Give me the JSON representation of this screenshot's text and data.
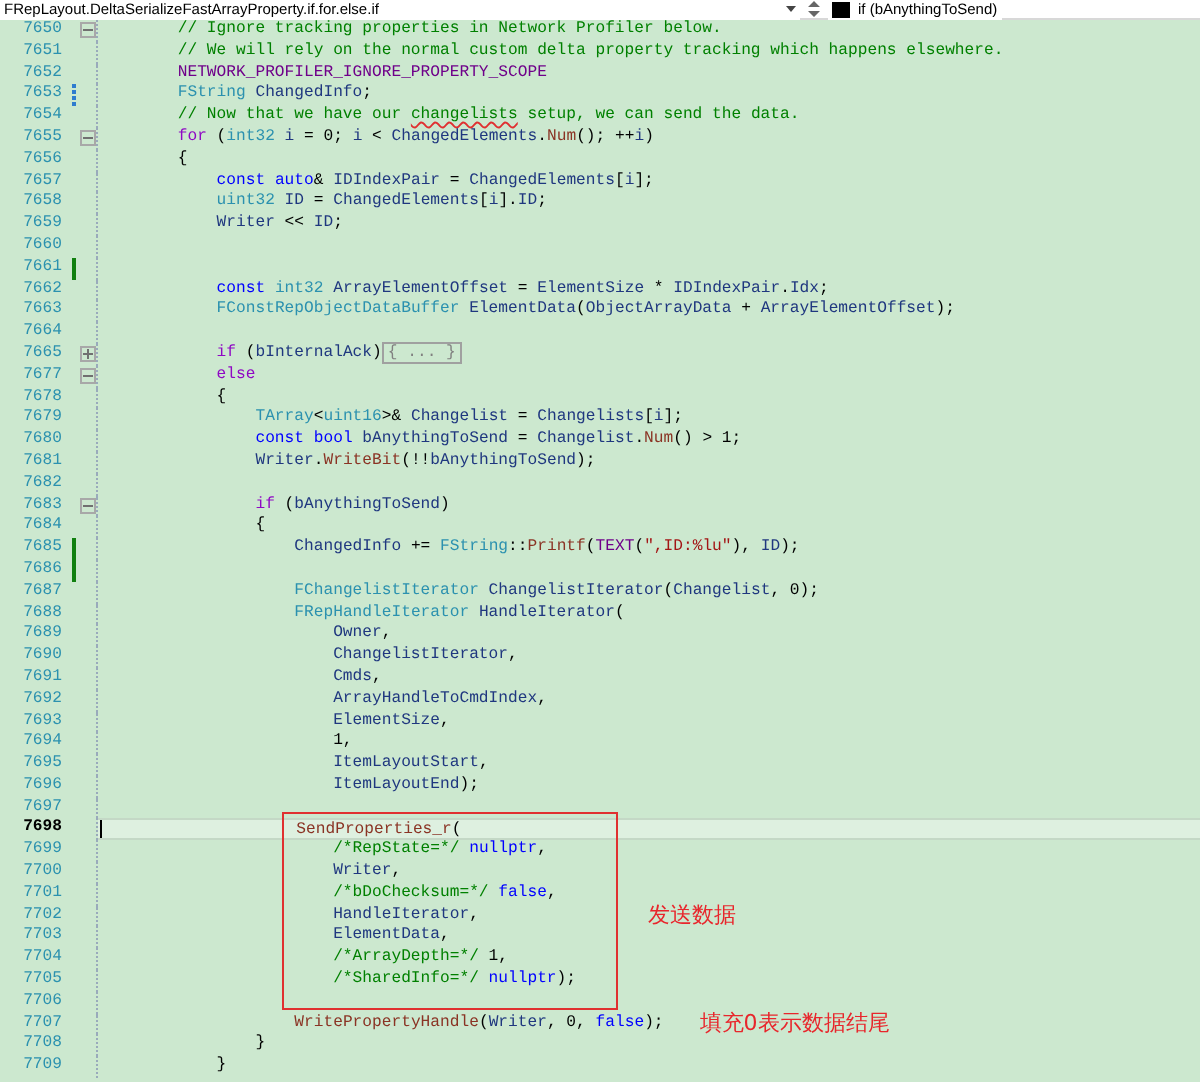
{
  "navigation_bar": {
    "scope": "FRepLayout.DeltaSerializeFastArrayProperty.if.for.else.if",
    "member": "if (bAnythingToSend)"
  },
  "lines": [
    {
      "number": "7650",
      "folded": false,
      "current": false,
      "tokens": [
        {
          "kind": "comment",
          "text": "        // Ignore tracking properties in Network Profiler below."
        }
      ]
    },
    {
      "number": "7651",
      "current": false,
      "tokens": [
        {
          "kind": "comment",
          "text": "        // We will rely on the normal custom delta property tracking which happens elsewhere."
        }
      ]
    },
    {
      "number": "7652",
      "current": false,
      "tokens": [
        {
          "kind": "macro",
          "text": "        NETWORK_PROFILER_IGNORE_PROPERTY_SCOPE"
        }
      ]
    },
    {
      "number": "7653",
      "change_marker": {
        "kind": "reverted"
      },
      "current": false,
      "tokens": [
        {
          "kind": "type",
          "text": "        FString"
        },
        {
          "kind": "variable",
          "text": " ChangedInfo"
        },
        {
          "kind": "plain",
          "text": ";"
        }
      ]
    },
    {
      "number": "7654",
      "current": false,
      "tokens": [
        {
          "kind": "comment",
          "text": "        // Now that we have our "
        },
        {
          "kind": "misspelled",
          "text": "changelists"
        },
        {
          "kind": "comment",
          "text": " setup, we can send the data."
        }
      ]
    },
    {
      "number": "7655",
      "folded": false,
      "current": false,
      "tokens": [
        {
          "kind": "control",
          "text": "        for"
        },
        {
          "kind": "plain",
          "text": " ("
        },
        {
          "kind": "type",
          "text": "int32"
        },
        {
          "kind": "variable",
          "text": " i"
        },
        {
          "kind": "plain",
          "text": " = 0; "
        },
        {
          "kind": "variable",
          "text": "i"
        },
        {
          "kind": "plain",
          "text": " < "
        },
        {
          "kind": "variable",
          "text": "ChangedElements"
        },
        {
          "kind": "plain",
          "text": "."
        },
        {
          "kind": "function",
          "text": "Num"
        },
        {
          "kind": "plain",
          "text": "(); ++"
        },
        {
          "kind": "variable",
          "text": "i"
        },
        {
          "kind": "plain",
          "text": ")"
        }
      ]
    },
    {
      "number": "7656",
      "current": false,
      "tokens": [
        {
          "kind": "plain",
          "text": "        {"
        }
      ]
    },
    {
      "number": "7657",
      "current": false,
      "tokens": [
        {
          "kind": "keyword",
          "text": "            const"
        },
        {
          "kind": "keyword",
          "text": " auto"
        },
        {
          "kind": "plain",
          "text": "& "
        },
        {
          "kind": "variable",
          "text": "IDIndexPair"
        },
        {
          "kind": "plain",
          "text": " = "
        },
        {
          "kind": "variable",
          "text": "ChangedElements"
        },
        {
          "kind": "plain",
          "text": "["
        },
        {
          "kind": "variable",
          "text": "i"
        },
        {
          "kind": "plain",
          "text": "];"
        }
      ]
    },
    {
      "number": "7658",
      "current": false,
      "tokens": [
        {
          "kind": "type",
          "text": "            uint32"
        },
        {
          "kind": "variable",
          "text": " ID"
        },
        {
          "kind": "plain",
          "text": " = "
        },
        {
          "kind": "variable",
          "text": "ChangedElements"
        },
        {
          "kind": "plain",
          "text": "["
        },
        {
          "kind": "variable",
          "text": "i"
        },
        {
          "kind": "plain",
          "text": "]."
        },
        {
          "kind": "variable",
          "text": "ID"
        },
        {
          "kind": "plain",
          "text": ";"
        }
      ]
    },
    {
      "number": "7659",
      "current": false,
      "tokens": [
        {
          "kind": "variable",
          "text": "            Writer"
        },
        {
          "kind": "plain",
          "text": " << "
        },
        {
          "kind": "variable",
          "text": "ID"
        },
        {
          "kind": "plain",
          "text": ";"
        }
      ]
    },
    {
      "number": "7660",
      "current": false
    },
    {
      "number": "7661",
      "change_marker": {
        "kind": "saved"
      },
      "current": false
    },
    {
      "number": "7662",
      "current": false,
      "tokens": [
        {
          "kind": "keyword",
          "text": "            const"
        },
        {
          "kind": "type",
          "text": " int32"
        },
        {
          "kind": "variable",
          "text": " ArrayElementOffset"
        },
        {
          "kind": "plain",
          "text": " = "
        },
        {
          "kind": "variable",
          "text": "ElementSize"
        },
        {
          "kind": "plain",
          "text": " * "
        },
        {
          "kind": "variable",
          "text": "IDIndexPair"
        },
        {
          "kind": "plain",
          "text": "."
        },
        {
          "kind": "variable",
          "text": "Idx"
        },
        {
          "kind": "plain",
          "text": ";"
        }
      ]
    },
    {
      "number": "7663",
      "current": false,
      "tokens": [
        {
          "kind": "type",
          "text": "            FConstRepObjectDataBuffer"
        },
        {
          "kind": "variable",
          "text": " ElementData"
        },
        {
          "kind": "plain",
          "text": "("
        },
        {
          "kind": "variable",
          "text": "ObjectArrayData"
        },
        {
          "kind": "plain",
          "text": " + "
        },
        {
          "kind": "variable",
          "text": "ArrayElementOffset"
        },
        {
          "kind": "plain",
          "text": ");"
        }
      ]
    },
    {
      "number": "7664",
      "current": false
    },
    {
      "number": "7665",
      "folded": true,
      "current": false,
      "tokens": [
        {
          "kind": "control",
          "text": "            if"
        },
        {
          "kind": "plain",
          "text": " ("
        },
        {
          "kind": "variable",
          "text": "bInternalAck"
        },
        {
          "kind": "plain",
          "text": ")"
        },
        {
          "kind": "collapsed",
          "text": "{ ... }"
        }
      ]
    },
    {
      "number": "7677",
      "folded": false,
      "current": false,
      "tokens": [
        {
          "kind": "control",
          "text": "            else"
        }
      ]
    },
    {
      "number": "7678",
      "current": false,
      "tokens": [
        {
          "kind": "plain",
          "text": "            {"
        }
      ]
    },
    {
      "number": "7679",
      "current": false,
      "tokens": [
        {
          "kind": "type",
          "text": "                TArray"
        },
        {
          "kind": "plain",
          "text": "<"
        },
        {
          "kind": "type",
          "text": "uint16"
        },
        {
          "kind": "plain",
          "text": ">& "
        },
        {
          "kind": "variable",
          "text": "Changelist"
        },
        {
          "kind": "plain",
          "text": " = "
        },
        {
          "kind": "variable",
          "text": "Changelists"
        },
        {
          "kind": "plain",
          "text": "["
        },
        {
          "kind": "variable",
          "text": "i"
        },
        {
          "kind": "plain",
          "text": "];"
        }
      ]
    },
    {
      "number": "7680",
      "current": false,
      "tokens": [
        {
          "kind": "keyword",
          "text": "                const"
        },
        {
          "kind": "keyword",
          "text": " bool"
        },
        {
          "kind": "variable",
          "text": " bAnythingToSend"
        },
        {
          "kind": "plain",
          "text": " = "
        },
        {
          "kind": "variable",
          "text": "Changelist"
        },
        {
          "kind": "plain",
          "text": "."
        },
        {
          "kind": "function",
          "text": "Num"
        },
        {
          "kind": "plain",
          "text": "() > 1;"
        }
      ]
    },
    {
      "number": "7681",
      "current": false,
      "tokens": [
        {
          "kind": "variable",
          "text": "                Writer"
        },
        {
          "kind": "plain",
          "text": "."
        },
        {
          "kind": "function",
          "text": "WriteBit"
        },
        {
          "kind": "plain",
          "text": "(!!"
        },
        {
          "kind": "variable",
          "text": "bAnythingToSend"
        },
        {
          "kind": "plain",
          "text": ");"
        }
      ]
    },
    {
      "number": "7682",
      "current": false
    },
    {
      "number": "7683",
      "folded": false,
      "current": false,
      "tokens": [
        {
          "kind": "control",
          "text": "                if"
        },
        {
          "kind": "plain",
          "text": " ("
        },
        {
          "kind": "variable",
          "text": "bAnythingToSend"
        },
        {
          "kind": "plain",
          "text": ")"
        }
      ]
    },
    {
      "number": "7684",
      "current": false,
      "tokens": [
        {
          "kind": "plain",
          "text": "                {"
        }
      ]
    },
    {
      "number": "7685",
      "change_marker": {
        "kind": "saved"
      },
      "current": false,
      "tokens": [
        {
          "kind": "variable",
          "text": "                    ChangedInfo"
        },
        {
          "kind": "plain",
          "text": " += "
        },
        {
          "kind": "type",
          "text": "FString"
        },
        {
          "kind": "plain",
          "text": "::"
        },
        {
          "kind": "function",
          "text": "Printf"
        },
        {
          "kind": "plain",
          "text": "("
        },
        {
          "kind": "macro",
          "text": "TEXT"
        },
        {
          "kind": "plain",
          "text": "("
        },
        {
          "kind": "string",
          "text": "\",ID:%lu\""
        },
        {
          "kind": "plain",
          "text": "), "
        },
        {
          "kind": "variable",
          "text": "ID"
        },
        {
          "kind": "plain",
          "text": ");"
        }
      ]
    },
    {
      "number": "7686",
      "change_marker": {
        "kind": "saved"
      },
      "current": false
    },
    {
      "number": "7687",
      "current": false,
      "tokens": [
        {
          "kind": "type",
          "text": "                    FChangelistIterator"
        },
        {
          "kind": "variable",
          "text": " ChangelistIterator"
        },
        {
          "kind": "plain",
          "text": "("
        },
        {
          "kind": "variable",
          "text": "Changelist"
        },
        {
          "kind": "plain",
          "text": ", 0);"
        }
      ]
    },
    {
      "number": "7688",
      "current": false,
      "tokens": [
        {
          "kind": "type",
          "text": "                    FRepHandleIterator"
        },
        {
          "kind": "variable",
          "text": " HandleIterator"
        },
        {
          "kind": "plain",
          "text": "("
        }
      ]
    },
    {
      "number": "7689",
      "current": false,
      "tokens": [
        {
          "kind": "variable",
          "text": "                        Owner"
        },
        {
          "kind": "plain",
          "text": ","
        }
      ]
    },
    {
      "number": "7690",
      "current": false,
      "tokens": [
        {
          "kind": "variable",
          "text": "                        ChangelistIterator"
        },
        {
          "kind": "plain",
          "text": ","
        }
      ]
    },
    {
      "number": "7691",
      "current": false,
      "tokens": [
        {
          "kind": "variable",
          "text": "                        Cmds"
        },
        {
          "kind": "plain",
          "text": ","
        }
      ]
    },
    {
      "number": "7692",
      "current": false,
      "tokens": [
        {
          "kind": "variable",
          "text": "                        ArrayHandleToCmdIndex"
        },
        {
          "kind": "plain",
          "text": ","
        }
      ]
    },
    {
      "number": "7693",
      "current": false,
      "tokens": [
        {
          "kind": "variable",
          "text": "                        ElementSize"
        },
        {
          "kind": "plain",
          "text": ","
        }
      ]
    },
    {
      "number": "7694",
      "current": false,
      "tokens": [
        {
          "kind": "plain",
          "text": "                        1,"
        }
      ]
    },
    {
      "number": "7695",
      "current": false,
      "tokens": [
        {
          "kind": "variable",
          "text": "                        ItemLayoutStart"
        },
        {
          "kind": "plain",
          "text": ","
        }
      ]
    },
    {
      "number": "7696",
      "current": false,
      "tokens": [
        {
          "kind": "variable",
          "text": "                        ItemLayoutEnd"
        },
        {
          "kind": "plain",
          "text": ");"
        }
      ]
    },
    {
      "number": "7697",
      "current": false
    }
  ],
  "annotation_box": {
    "lines": [
      {
        "number": "7698",
        "current": true,
        "tokens": [
          {
            "kind": "function",
            "text": "                    SendProperties_r"
          },
          {
            "kind": "plain",
            "text": "("
          }
        ]
      },
      {
        "number": "7699",
        "current": false,
        "tokens": [
          {
            "kind": "comment",
            "text": "                        /*RepState=*/"
          },
          {
            "kind": "keyword",
            "text": " nullptr"
          },
          {
            "kind": "plain",
            "text": ","
          }
        ]
      },
      {
        "number": "7700",
        "current": false,
        "tokens": [
          {
            "kind": "variable",
            "text": "                        Writer"
          },
          {
            "kind": "plain",
            "text": ","
          }
        ]
      },
      {
        "number": "7701",
        "current": false,
        "tokens": [
          {
            "kind": "comment",
            "text": "                        /*bDoChecksum=*/"
          },
          {
            "kind": "keyword",
            "text": " false"
          },
          {
            "kind": "plain",
            "text": ","
          }
        ]
      },
      {
        "number": "7702",
        "current": false,
        "note": "发送数据",
        "tokens": [
          {
            "kind": "variable",
            "text": "                        HandleIterator"
          },
          {
            "kind": "plain",
            "text": ","
          }
        ]
      },
      {
        "number": "7703",
        "current": false,
        "tokens": [
          {
            "kind": "variable",
            "text": "                        ElementData"
          },
          {
            "kind": "plain",
            "text": ","
          }
        ]
      },
      {
        "number": "7704",
        "current": false,
        "tokens": [
          {
            "kind": "comment",
            "text": "                        /*ArrayDepth=*/"
          },
          {
            "kind": "plain",
            "text": " 1,"
          }
        ]
      },
      {
        "number": "7705",
        "current": false,
        "tokens": [
          {
            "kind": "comment",
            "text": "                        /*SharedInfo=*/"
          },
          {
            "kind": "keyword",
            "text": " nullptr"
          },
          {
            "kind": "plain",
            "text": ");"
          }
        ]
      },
      {
        "number": "7706",
        "current": false
      }
    ]
  },
  "lines_after_box": [
    {
      "number": "7707",
      "current": false,
      "note": "填充0表示数据结尾",
      "tokens": [
        {
          "kind": "function",
          "text": "                    WritePropertyHandle"
        },
        {
          "kind": "plain",
          "text": "("
        },
        {
          "kind": "variable",
          "text": "Writer"
        },
        {
          "kind": "plain",
          "text": ", 0, "
        },
        {
          "kind": "keyword",
          "text": "false"
        },
        {
          "kind": "plain",
          "text": ");"
        }
      ]
    },
    {
      "number": "7708",
      "current": false,
      "tokens": [
        {
          "kind": "plain",
          "text": "                }"
        }
      ]
    },
    {
      "number": "7709",
      "current": false,
      "tokens": [
        {
          "kind": "plain",
          "text": "            }"
        }
      ]
    }
  ]
}
